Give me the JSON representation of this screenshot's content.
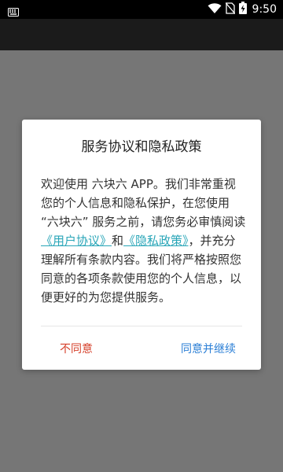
{
  "status_bar": {
    "time": "9:50",
    "icons": [
      "keyboard-icon",
      "wifi-icon",
      "no-sim-icon",
      "battery-charging-icon"
    ]
  },
  "dialog": {
    "title": "服务协议和隐私政策",
    "body_intro": "欢迎使用 六块六 APP。我们非常重视您的个人信息和隐私保护，在您使用 “六块六” 服务之前，请您务必审慎阅读",
    "link_user_agreement": "《用户协议》",
    "body_and": "和",
    "link_privacy_policy": "《隐私政策》",
    "body_outro": "，并充分理解所有条款内容。我们将严格按照您同意的各项条款使用您的个人信息，以便更好的为您提供服务。",
    "decline_label": "不同意",
    "accept_label": "同意并继续"
  },
  "colors": {
    "accent_link": "#2aa6b8",
    "decline": "#d6412b",
    "accept": "#2b7fd6"
  }
}
